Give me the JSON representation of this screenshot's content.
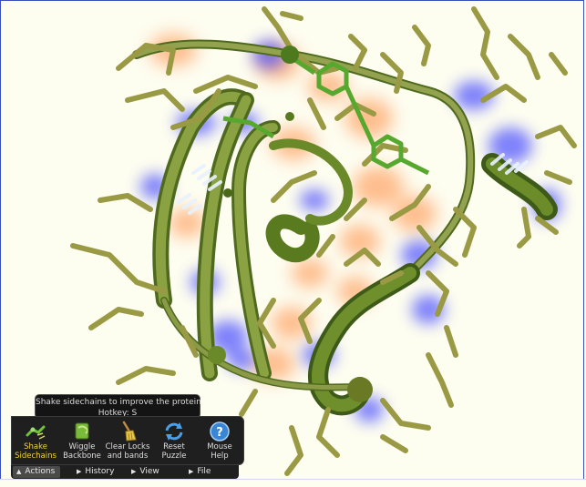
{
  "tooltip": {
    "line1": "Shake sidechains to improve the protein",
    "line2": "Hotkey: S"
  },
  "toolbar": {
    "tools": [
      {
        "line1": "Shake",
        "line2": "Sidechains",
        "icon": "shake-sidechains-icon",
        "active": true
      },
      {
        "line1": "Wiggle",
        "line2": "Backbone",
        "icon": "wiggle-backbone-icon",
        "active": false
      },
      {
        "line1": "Clear Locks",
        "line2": "and bands",
        "icon": "broom-icon",
        "active": false
      },
      {
        "line1": "Reset",
        "line2": "Puzzle",
        "icon": "reset-icon",
        "active": false
      },
      {
        "line1": "Mouse",
        "line2": "Help",
        "icon": "help-icon",
        "active": false
      }
    ],
    "active_color": "#f0d23a"
  },
  "tabs": [
    {
      "label": "Actions",
      "arrow": "▲",
      "selected": true
    },
    {
      "label": "History",
      "arrow": "▶",
      "selected": false
    },
    {
      "label": "View",
      "arrow": "▶",
      "selected": false
    },
    {
      "label": "File",
      "arrow": "▶",
      "selected": false
    }
  ],
  "colors": {
    "background": "#fdfdf0",
    "sidechain": "#9a9a45",
    "backbone": "#5f7a2a",
    "aromatic": "#57a82e",
    "hydrophobic_glow": "#ff8a3c",
    "polar_glow": "#4a4dff"
  }
}
